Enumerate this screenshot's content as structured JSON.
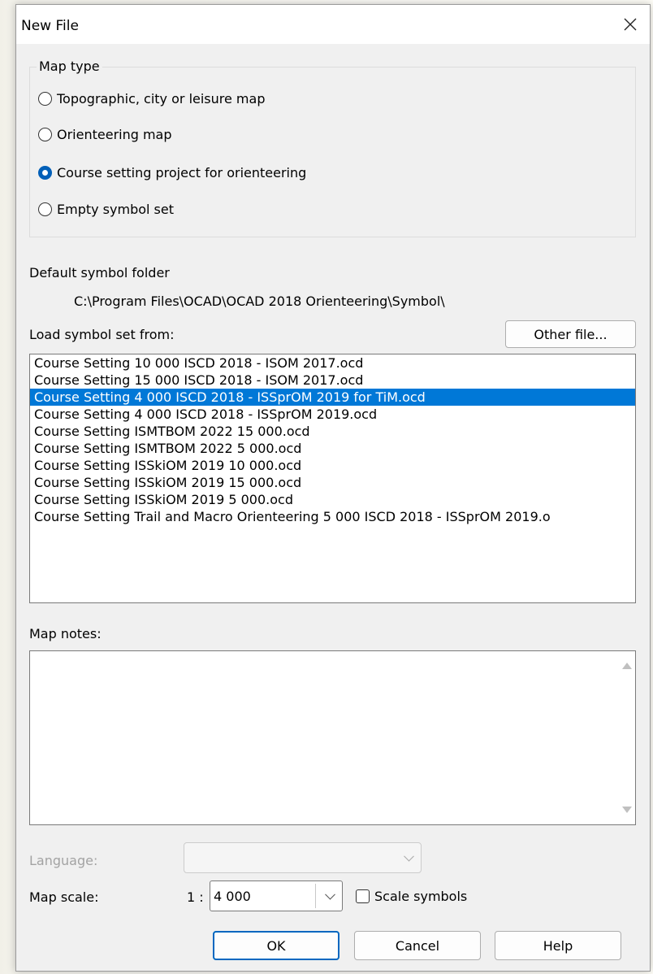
{
  "dialog": {
    "title": "New File",
    "close_icon": "close-icon"
  },
  "map_type": {
    "legend": "Map type",
    "options": [
      {
        "label": "Topographic, city or leisure map",
        "checked": false
      },
      {
        "label": "Orienteering map",
        "checked": false
      },
      {
        "label": "Course setting project for orienteering",
        "checked": true
      },
      {
        "label": "Empty symbol set",
        "checked": false
      }
    ]
  },
  "symbol_folder": {
    "label": "Default symbol folder",
    "path": "C:\\Program Files\\OCAD\\OCAD 2018 Orienteering\\Symbol\\"
  },
  "load_symbol": {
    "label": "Load symbol set from:",
    "other_file_label": "Other file...",
    "items": [
      "Course Setting 10 000 ISCD 2018 - ISOM 2017.ocd",
      "Course Setting 15 000 ISCD 2018 - ISOM 2017.ocd",
      "Course Setting 4 000 ISCD 2018 - ISSprOM 2019 for TiM.ocd",
      "Course Setting 4 000 ISCD 2018 - ISSprOM 2019.ocd",
      "Course Setting ISMTBOM 2022 15 000.ocd",
      "Course Setting ISMTBOM 2022 5 000.ocd",
      "Course Setting ISSkiOM 2019 10 000.ocd",
      "Course Setting ISSkiOM 2019 15 000.ocd",
      "Course Setting ISSkiOM 2019 5 000.ocd",
      "Course Setting Trail and Macro Orienteering 5 000 ISCD 2018 - ISSprOM 2019.o"
    ],
    "selected_index": 2
  },
  "map_notes": {
    "label": "Map notes:",
    "value": ""
  },
  "language": {
    "label": "Language:",
    "value": ""
  },
  "map_scale": {
    "label": "Map scale:",
    "prefix": "1 :",
    "value": "4 000",
    "scale_symbols_label": "Scale symbols",
    "scale_symbols_checked": false
  },
  "buttons": {
    "ok": "OK",
    "cancel": "Cancel",
    "help": "Help"
  },
  "colors": {
    "accent": "#005fb8",
    "selection": "#0078d7"
  }
}
